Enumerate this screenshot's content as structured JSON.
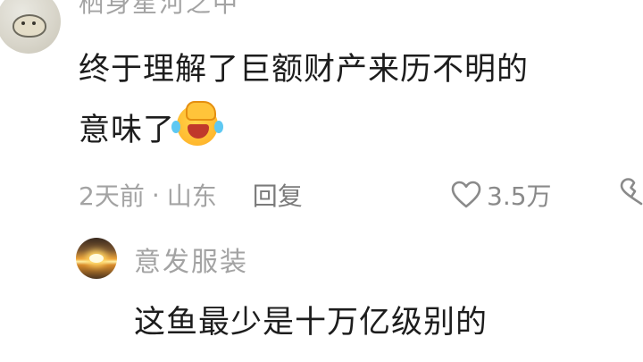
{
  "main_comment": {
    "username": "栖身星河之中",
    "text_line1": "终于理解了巨额财产来历不明的",
    "text_line2": "意味了",
    "emoji": "facepalm-laugh-emoji",
    "time": "2天前",
    "separator": "·",
    "location": "山东",
    "reply_label": "回复",
    "like_count": "3.5万"
  },
  "reply_comment": {
    "username": "意发服装",
    "text": "这鱼最少是十万亿级别的"
  }
}
